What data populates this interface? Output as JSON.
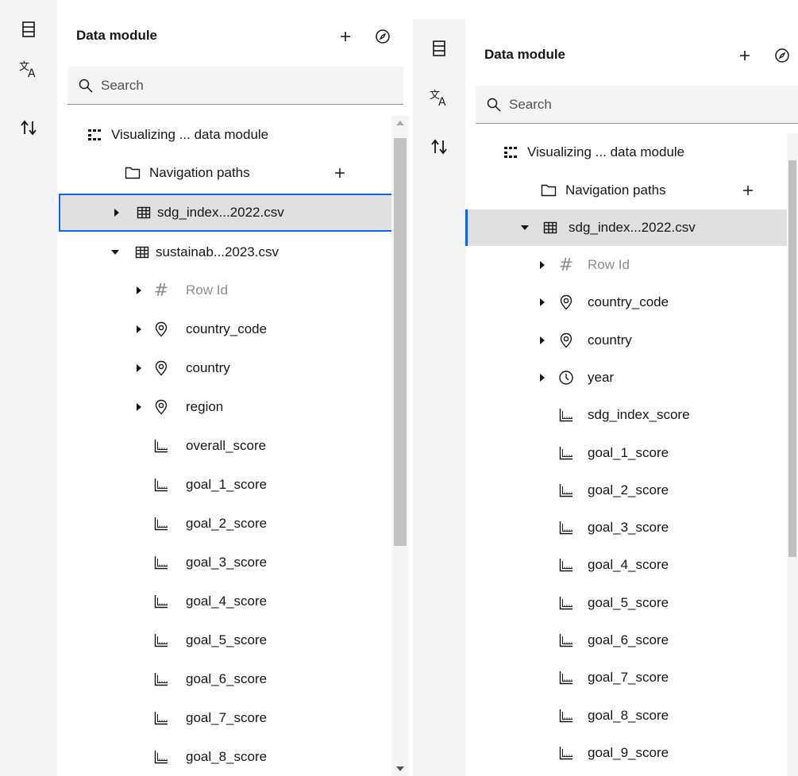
{
  "left_panel": {
    "title": "Data module",
    "search_placeholder": "Search",
    "tree": {
      "root_label": "Visualizing ... data module",
      "nav_paths_label": "Navigation paths",
      "table1_label": "sdg_index...2022.csv",
      "table2_label": "sustainab...2023.csv",
      "fields": [
        {
          "label": "Row Id",
          "icon": "hash-icon",
          "expandable": true,
          "muted": true
        },
        {
          "label": "country_code",
          "icon": "location-icon",
          "expandable": true,
          "muted": false
        },
        {
          "label": "country",
          "icon": "location-icon",
          "expandable": true,
          "muted": false
        },
        {
          "label": "region",
          "icon": "location-icon",
          "expandable": true,
          "muted": false
        },
        {
          "label": "overall_score",
          "icon": "measure-icon",
          "expandable": false,
          "muted": false
        },
        {
          "label": "goal_1_score",
          "icon": "measure-icon",
          "expandable": false,
          "muted": false
        },
        {
          "label": "goal_2_score",
          "icon": "measure-icon",
          "expandable": false,
          "muted": false
        },
        {
          "label": "goal_3_score",
          "icon": "measure-icon",
          "expandable": false,
          "muted": false
        },
        {
          "label": "goal_4_score",
          "icon": "measure-icon",
          "expandable": false,
          "muted": false
        },
        {
          "label": "goal_5_score",
          "icon": "measure-icon",
          "expandable": false,
          "muted": false
        },
        {
          "label": "goal_6_score",
          "icon": "measure-icon",
          "expandable": false,
          "muted": false
        },
        {
          "label": "goal_7_score",
          "icon": "measure-icon",
          "expandable": false,
          "muted": false
        },
        {
          "label": "goal_8_score",
          "icon": "measure-icon",
          "expandable": false,
          "muted": false
        }
      ]
    }
  },
  "right_panel": {
    "title": "Data module",
    "search_placeholder": "Search",
    "tree": {
      "root_label": "Visualizing ... data module",
      "nav_paths_label": "Navigation paths",
      "table1_label": "sdg_index...2022.csv",
      "fields": [
        {
          "label": "Row Id",
          "icon": "hash-icon",
          "expandable": true,
          "muted": true
        },
        {
          "label": "country_code",
          "icon": "location-icon",
          "expandable": true,
          "muted": false
        },
        {
          "label": "country",
          "icon": "location-icon",
          "expandable": true,
          "muted": false
        },
        {
          "label": "year",
          "icon": "clock-icon",
          "expandable": true,
          "muted": false
        },
        {
          "label": "sdg_index_score",
          "icon": "measure-icon",
          "expandable": false,
          "muted": false
        },
        {
          "label": "goal_1_score",
          "icon": "measure-icon",
          "expandable": false,
          "muted": false
        },
        {
          "label": "goal_2_score",
          "icon": "measure-icon",
          "expandable": false,
          "muted": false
        },
        {
          "label": "goal_3_score",
          "icon": "measure-icon",
          "expandable": false,
          "muted": false
        },
        {
          "label": "goal_4_score",
          "icon": "measure-icon",
          "expandable": false,
          "muted": false
        },
        {
          "label": "goal_5_score",
          "icon": "measure-icon",
          "expandable": false,
          "muted": false
        },
        {
          "label": "goal_6_score",
          "icon": "measure-icon",
          "expandable": false,
          "muted": false
        },
        {
          "label": "goal_7_score",
          "icon": "measure-icon",
          "expandable": false,
          "muted": false
        },
        {
          "label": "goal_8_score",
          "icon": "measure-icon",
          "expandable": false,
          "muted": false
        },
        {
          "label": "goal_9_score",
          "icon": "measure-icon",
          "expandable": false,
          "muted": false
        }
      ]
    }
  },
  "colors": {
    "focus_border": "#0f62fe",
    "selected_bg": "#e0e0e0",
    "rail_bg": "#f4f4f4",
    "muted_text": "#8d8d8d"
  }
}
